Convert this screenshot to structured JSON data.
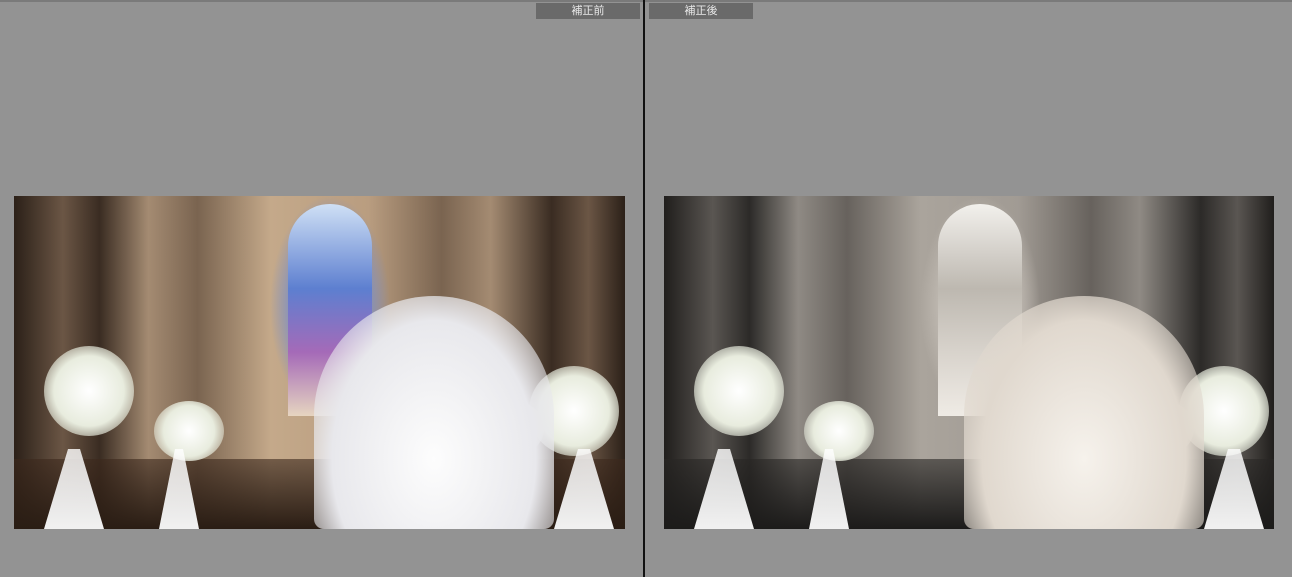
{
  "compare": {
    "before_label": "補正前",
    "after_label": "補正後"
  },
  "images": {
    "before": "wedding-photo-original-color",
    "after": "wedding-photo-corrected-sepia"
  }
}
